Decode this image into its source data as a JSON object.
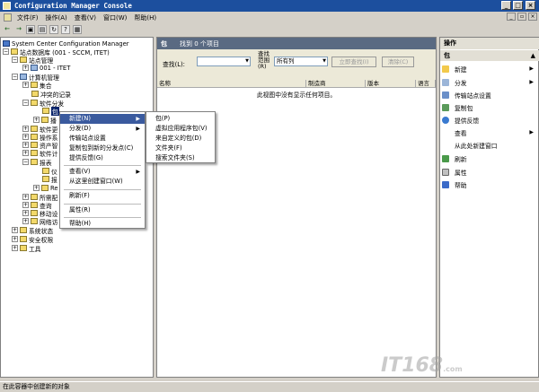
{
  "window": {
    "title": "Configuration Manager Console"
  },
  "menu": [
    "文件(F)",
    "操作(A)",
    "查看(V)",
    "窗口(W)",
    "帮助(H)"
  ],
  "tree": [
    {
      "label": "System Center Configuration Manager"
    },
    {
      "label": "站点数据库 (001 - SCCM, ITET)"
    },
    {
      "label": "站点管理"
    },
    {
      "label": "001 - ITET"
    },
    {
      "label": "计算机管理"
    },
    {
      "label": "集合"
    },
    {
      "label": "冲突的记录"
    },
    {
      "label": "软件分发"
    },
    {
      "label": "包"
    },
    {
      "label": "播"
    },
    {
      "label": "软件更"
    },
    {
      "label": "操作系"
    },
    {
      "label": "资产智"
    },
    {
      "label": "软件计"
    },
    {
      "label": "报表"
    },
    {
      "label": "仪"
    },
    {
      "label": "报"
    },
    {
      "label": "Re"
    },
    {
      "label": "所需配"
    },
    {
      "label": "查询"
    },
    {
      "label": "移动设"
    },
    {
      "label": "网络访"
    },
    {
      "label": "系统状态"
    },
    {
      "label": "安全权限"
    },
    {
      "label": "工具"
    }
  ],
  "center": {
    "header": "包",
    "found": "找到 0 个项目",
    "search_label": "查找(L):",
    "scope_label": "查找范围(R)",
    "scope_value": "所有列",
    "find_now": "立即查找(I)",
    "clear": "清除(C)",
    "columns": [
      "名称",
      "制造商",
      "版本",
      "语言"
    ],
    "empty": "此视图中没有显示任何项目。"
  },
  "actions": {
    "header": "操作",
    "subheader": "包",
    "items": [
      {
        "label": "新建",
        "icon": "new-icon",
        "sub": true
      },
      {
        "label": "分发",
        "icon": "distribute-icon",
        "sub": true
      },
      {
        "label": "传输站点设置",
        "icon": "transfer-icon"
      },
      {
        "label": "复制包",
        "icon": "copy-package-icon"
      },
      {
        "label": "提供反馈",
        "icon": "feedback-icon"
      },
      {
        "label": "查看",
        "icon": "",
        "sub": true
      },
      {
        "label": "从此处新建窗口",
        "icon": ""
      },
      {
        "label": "刷新",
        "icon": "refresh-icon"
      },
      {
        "label": "属性",
        "icon": "properties-icon"
      },
      {
        "label": "帮助",
        "icon": "help-icon"
      }
    ]
  },
  "ctx1": [
    {
      "label": "新建(N)",
      "sub": true,
      "hl": true
    },
    {
      "label": "分发(D)",
      "sub": true
    },
    {
      "label": "传输站点设置"
    },
    {
      "label": "复制包到新的分发点(C)"
    },
    {
      "label": "提供反馈(G)"
    },
    {
      "label": "查看(V)",
      "sub": true
    },
    {
      "label": "从这里创建窗口(W)"
    },
    {
      "label": "刷新(F)"
    },
    {
      "label": "属性(R)"
    },
    {
      "label": "帮助(H)"
    }
  ],
  "ctx2": [
    {
      "label": "包(P)"
    },
    {
      "label": "虚拟应用程序包(V)"
    },
    {
      "label": "来自定义的包(D)"
    },
    {
      "label": "文件夹(F)"
    },
    {
      "label": "搜索文件夹(S)"
    }
  ],
  "status": "在此容器中创建新的对象",
  "watermark": "IT168",
  "watermark_sub": ".com"
}
